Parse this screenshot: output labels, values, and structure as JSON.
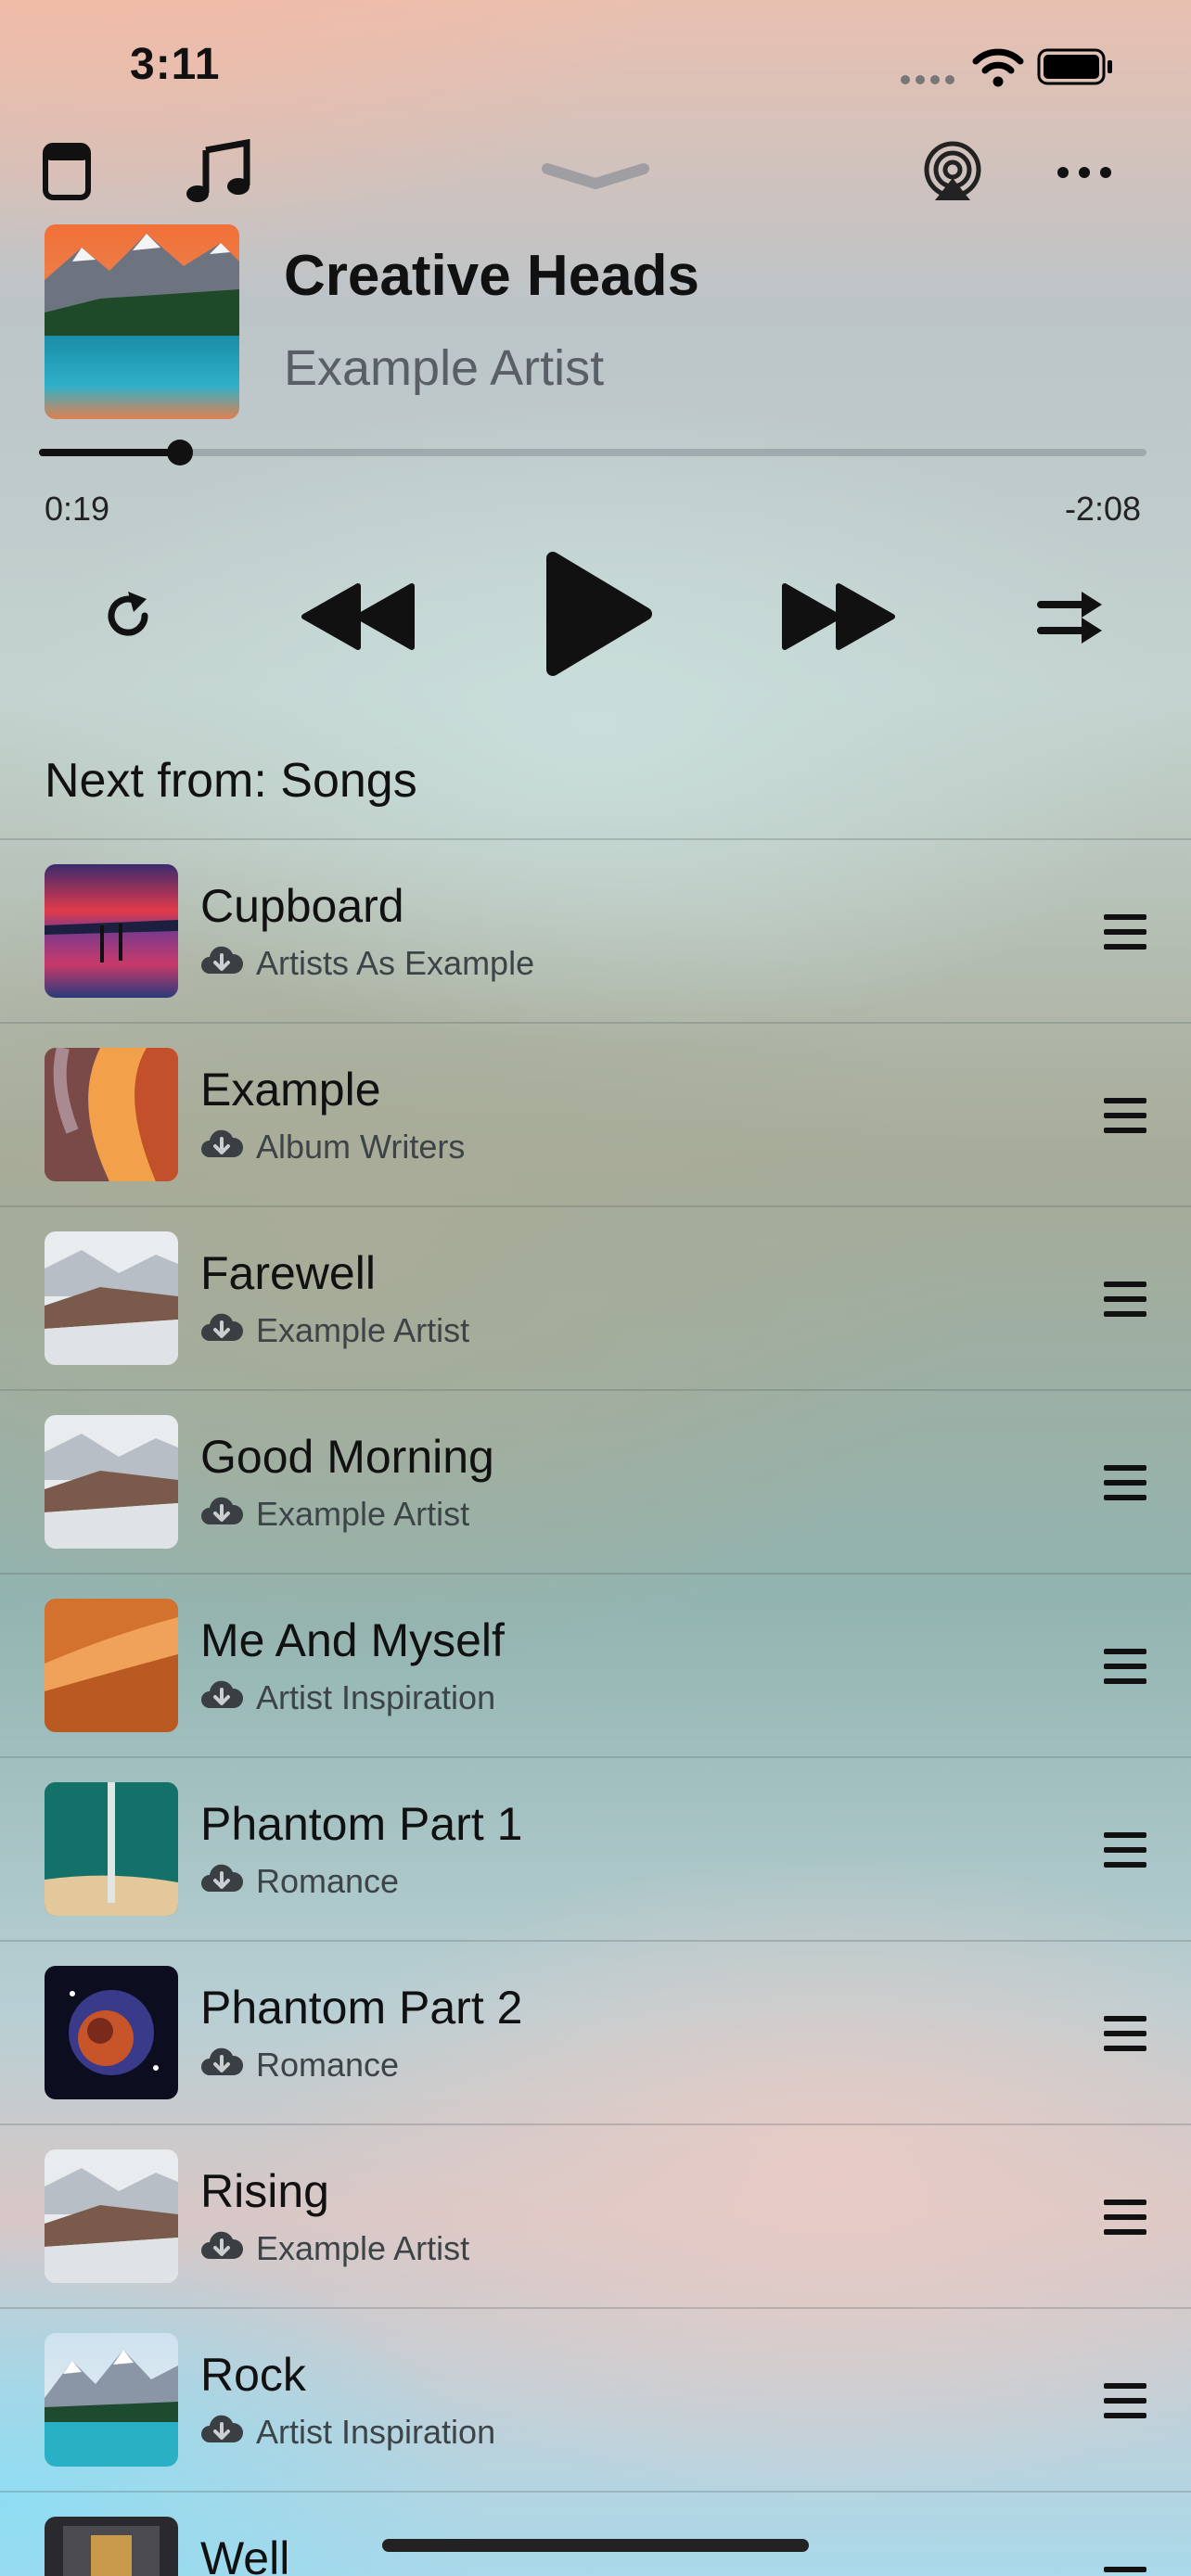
{
  "status_bar": {
    "time": "3:11"
  },
  "now_playing": {
    "title": "Creative Heads",
    "artist": "Example Artist",
    "progress_fraction": 0.1275,
    "elapsed": "0:19",
    "remaining": "-2:08"
  },
  "up_next": {
    "heading": "Next from: Songs",
    "songs": [
      {
        "title": "Cupboard",
        "artist": "Artists As Example"
      },
      {
        "title": "Example",
        "artist": "Album Writers"
      },
      {
        "title": "Farewell",
        "artist": "Example Artist"
      },
      {
        "title": "Good Morning",
        "artist": "Example Artist"
      },
      {
        "title": "Me And Myself",
        "artist": "Artist Inspiration"
      },
      {
        "title": "Phantom Part 1",
        "artist": "Romance"
      },
      {
        "title": "Phantom Part 2",
        "artist": "Romance"
      },
      {
        "title": "Rising",
        "artist": "Example Artist"
      },
      {
        "title": "Rock",
        "artist": "Artist Inspiration"
      },
      {
        "title": "Well",
        "artist": ""
      }
    ]
  },
  "icons": [
    "cellular-icon",
    "wifi-icon",
    "battery-icon",
    "miniplayer-icon",
    "music-note-icon",
    "chevron-down-icon",
    "airplay-icon",
    "more-icon",
    "repeat-icon",
    "previous-icon",
    "play-icon",
    "next-icon",
    "shuffle-icon",
    "cloud-download-icon",
    "reorder-handle-icon"
  ]
}
